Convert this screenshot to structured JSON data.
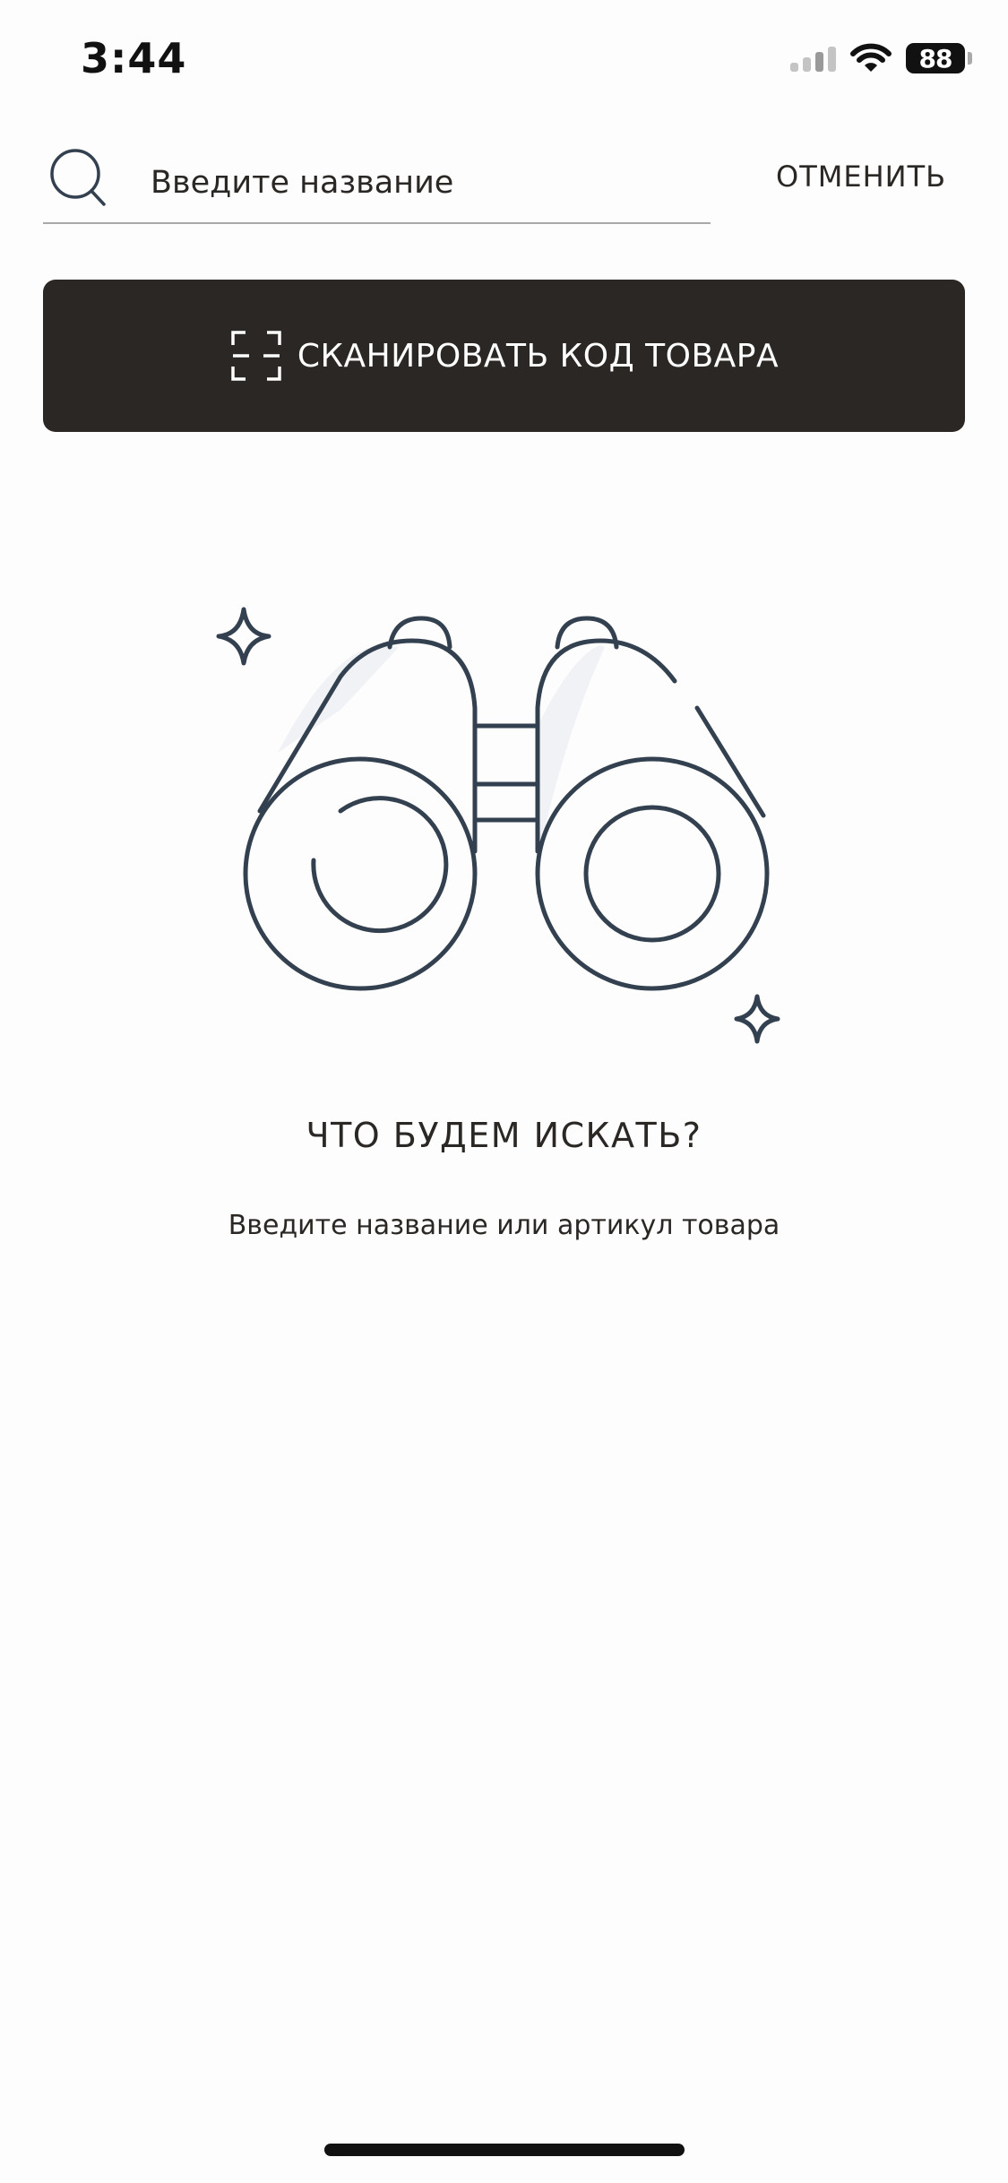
{
  "status_bar": {
    "time": "3:44",
    "battery": "88",
    "icons": [
      "cellular-signal-icon",
      "wifi-icon",
      "battery-icon"
    ]
  },
  "search": {
    "placeholder": "Введите название",
    "value": "",
    "cancel_label": "ОТМЕНИТЬ",
    "icon": "search-icon"
  },
  "scan_button": {
    "label": "СКАНИРОВАТЬ КОД ТОВАРА",
    "icon": "scan-frame-icon"
  },
  "empty_state": {
    "illustration": "binoculars-icon",
    "title": "ЧТО БУДЕМ ИСКАТЬ?",
    "subtitle": "Введите название или артикул товара"
  },
  "colors": {
    "button_bg": "#2a2724",
    "text": "#2a2724",
    "illustration_stroke": "#33404f",
    "background": "#fdfdfd"
  }
}
